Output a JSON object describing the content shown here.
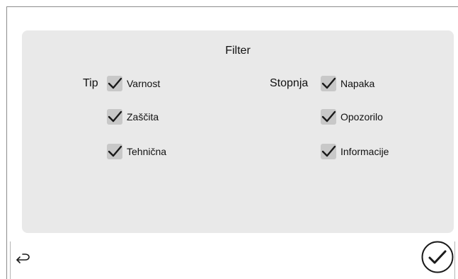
{
  "panel": {
    "title": "Filter"
  },
  "groups": {
    "tip": {
      "label": "Tip",
      "items": [
        {
          "label": "Varnost",
          "checked": true
        },
        {
          "label": "Zaščita",
          "checked": true
        },
        {
          "label": "Tehnična",
          "checked": true
        }
      ]
    },
    "stopnja": {
      "label": "Stopnja",
      "items": [
        {
          "label": "Napaka",
          "checked": true
        },
        {
          "label": "Opozorilo",
          "checked": true
        },
        {
          "label": "Informacije",
          "checked": true
        }
      ]
    }
  },
  "footer": {
    "back_icon": "back-arrow-icon",
    "confirm_icon": "checkmark-circle-icon"
  },
  "colors": {
    "panel_bg": "#e9e9e9",
    "checkbox_bg": "#c8c8c8",
    "check_stroke": "#1a1a1a"
  }
}
